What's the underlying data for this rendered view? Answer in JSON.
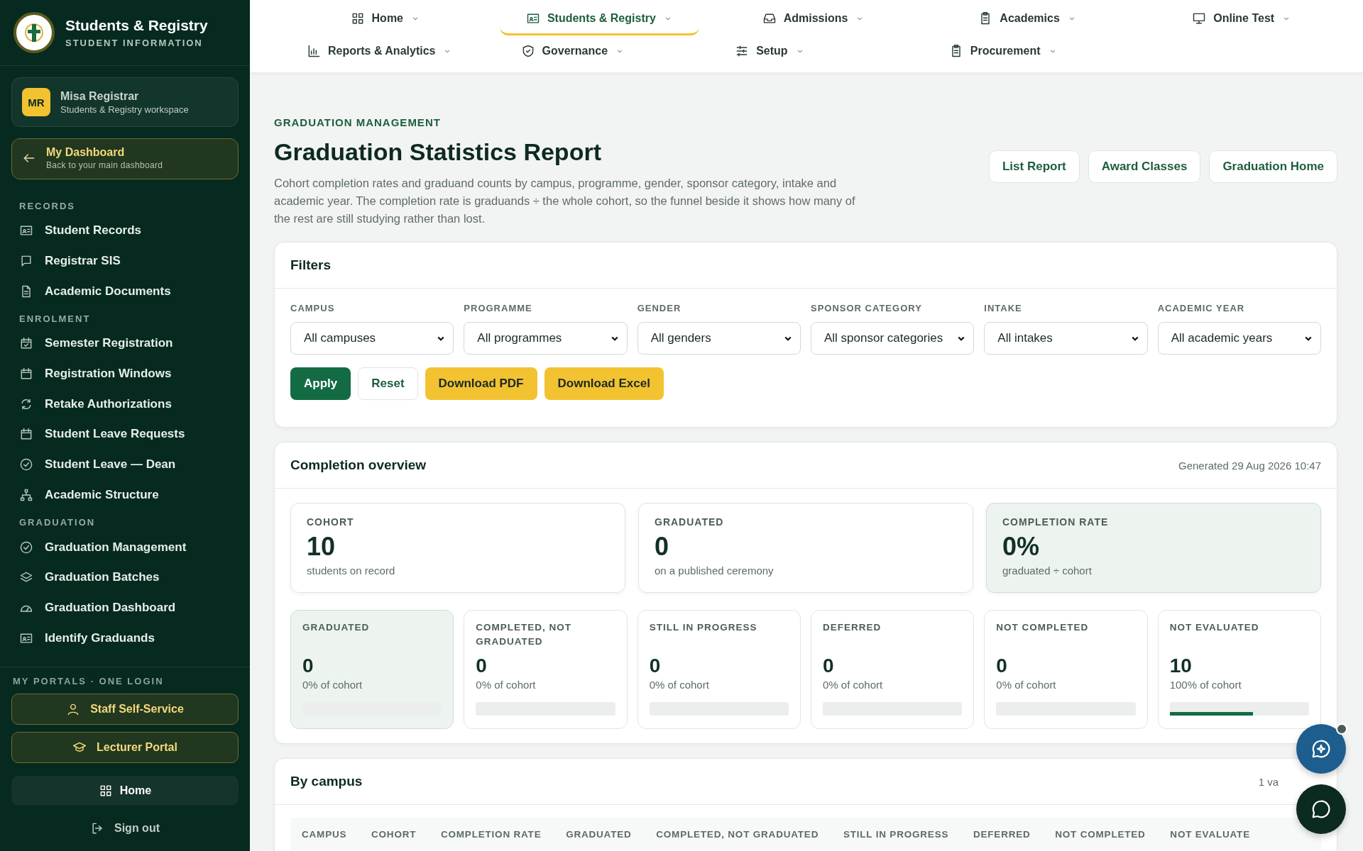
{
  "sidebar": {
    "brand_title": "Students & Registry",
    "brand_subtitle": "STUDENT INFORMATION",
    "user": {
      "initials": "MR",
      "name": "Misa Registrar",
      "workspace": "Students & Registry workspace"
    },
    "dashboard_link": {
      "title": "My Dashboard",
      "subtitle": "Back to your main dashboard"
    },
    "sections": [
      {
        "heading": "RECORDS",
        "items": [
          "Student Records",
          "Registrar SIS",
          "Academic Documents"
        ]
      },
      {
        "heading": "ENROLMENT",
        "items": [
          "Semester Registration",
          "Registration Windows",
          "Retake Authorizations",
          "Student Leave Requests",
          "Student Leave — Dean",
          "Academic Structure"
        ]
      },
      {
        "heading": "GRADUATION",
        "items": [
          "Graduation Management",
          "Graduation Batches",
          "Graduation Dashboard",
          "Identify Graduands"
        ]
      }
    ],
    "portals_heading": "MY PORTALS · ONE LOGIN",
    "portals": [
      "Staff Self-Service",
      "Lecturer Portal"
    ],
    "home": "Home",
    "sign_out": "Sign out"
  },
  "top_nav": [
    {
      "label": "Home",
      "selected": false
    },
    {
      "label": "Students & Registry",
      "selected": true
    },
    {
      "label": "Admissions",
      "selected": false
    },
    {
      "label": "Academics",
      "selected": false
    },
    {
      "label": "Online Test",
      "selected": false
    },
    {
      "label": "Reports & Analytics",
      "selected": false
    },
    {
      "label": "Governance",
      "selected": false
    },
    {
      "label": "Setup",
      "selected": false
    },
    {
      "label": "Procurement",
      "selected": false
    }
  ],
  "page": {
    "eyebrow": "GRADUATION MANAGEMENT",
    "title": "Graduation Statistics Report",
    "description": "Cohort completion rates and graduand counts by campus, programme, gender, sponsor category, intake and academic year. The completion rate is graduands ÷ the whole cohort, so the funnel beside it shows how many of the rest are still studying rather than lost.",
    "actions": [
      "List Report",
      "Award Classes",
      "Graduation Home"
    ]
  },
  "filters": {
    "title": "Filters",
    "fields": [
      {
        "label": "CAMPUS",
        "value": "All campuses"
      },
      {
        "label": "PROGRAMME",
        "value": "All programmes"
      },
      {
        "label": "GENDER",
        "value": "All genders"
      },
      {
        "label": "SPONSOR CATEGORY",
        "value": "All sponsor categories"
      },
      {
        "label": "INTAKE",
        "value": "All intakes"
      },
      {
        "label": "ACADEMIC YEAR",
        "value": "All academic years"
      }
    ],
    "buttons": [
      {
        "label": "Apply",
        "kind": "primary"
      },
      {
        "label": "Reset",
        "kind": "plain"
      },
      {
        "label": "Download PDF",
        "kind": "accent"
      },
      {
        "label": "Download Excel",
        "kind": "accent"
      }
    ]
  },
  "overview": {
    "title": "Completion overview",
    "generated": "Generated 29 Aug 2026 10:47",
    "summary": [
      {
        "label": "COHORT",
        "value": "10",
        "caption": "students on record",
        "highlighted": false
      },
      {
        "label": "GRADUATED",
        "value": "0",
        "caption": "on a published ceremony",
        "highlighted": false
      },
      {
        "label": "COMPLETION RATE",
        "value": "0%",
        "caption": "graduated ÷ cohort",
        "highlighted": true
      }
    ],
    "breakdown": [
      {
        "label": "GRADUATED",
        "value": "0",
        "caption": "0% of cohort",
        "highlighted": true
      },
      {
        "label": "COMPLETED, NOT GRADUATED",
        "value": "0",
        "caption": "0% of cohort",
        "highlighted": false
      },
      {
        "label": "STILL IN PROGRESS",
        "value": "0",
        "caption": "0% of cohort",
        "highlighted": false
      },
      {
        "label": "DEFERRED",
        "value": "0",
        "caption": "0% of cohort",
        "highlighted": false
      },
      {
        "label": "NOT COMPLETED",
        "value": "0",
        "caption": "0% of cohort",
        "highlighted": false
      },
      {
        "label": "NOT EVALUATED",
        "value": "10",
        "caption": "100% of cohort",
        "level": 0.6,
        "highlighted": false
      }
    ]
  },
  "by_campus": {
    "title": "By campus",
    "count": "1 va",
    "columns": [
      "CAMPUS",
      "COHORT",
      "COMPLETION RATE",
      "GRADUATED",
      "COMPLETED, NOT GRADUATED",
      "STILL IN PROGRESS",
      "DEFERRED",
      "NOT COMPLETED",
      "NOT EVALUATE"
    ]
  }
}
